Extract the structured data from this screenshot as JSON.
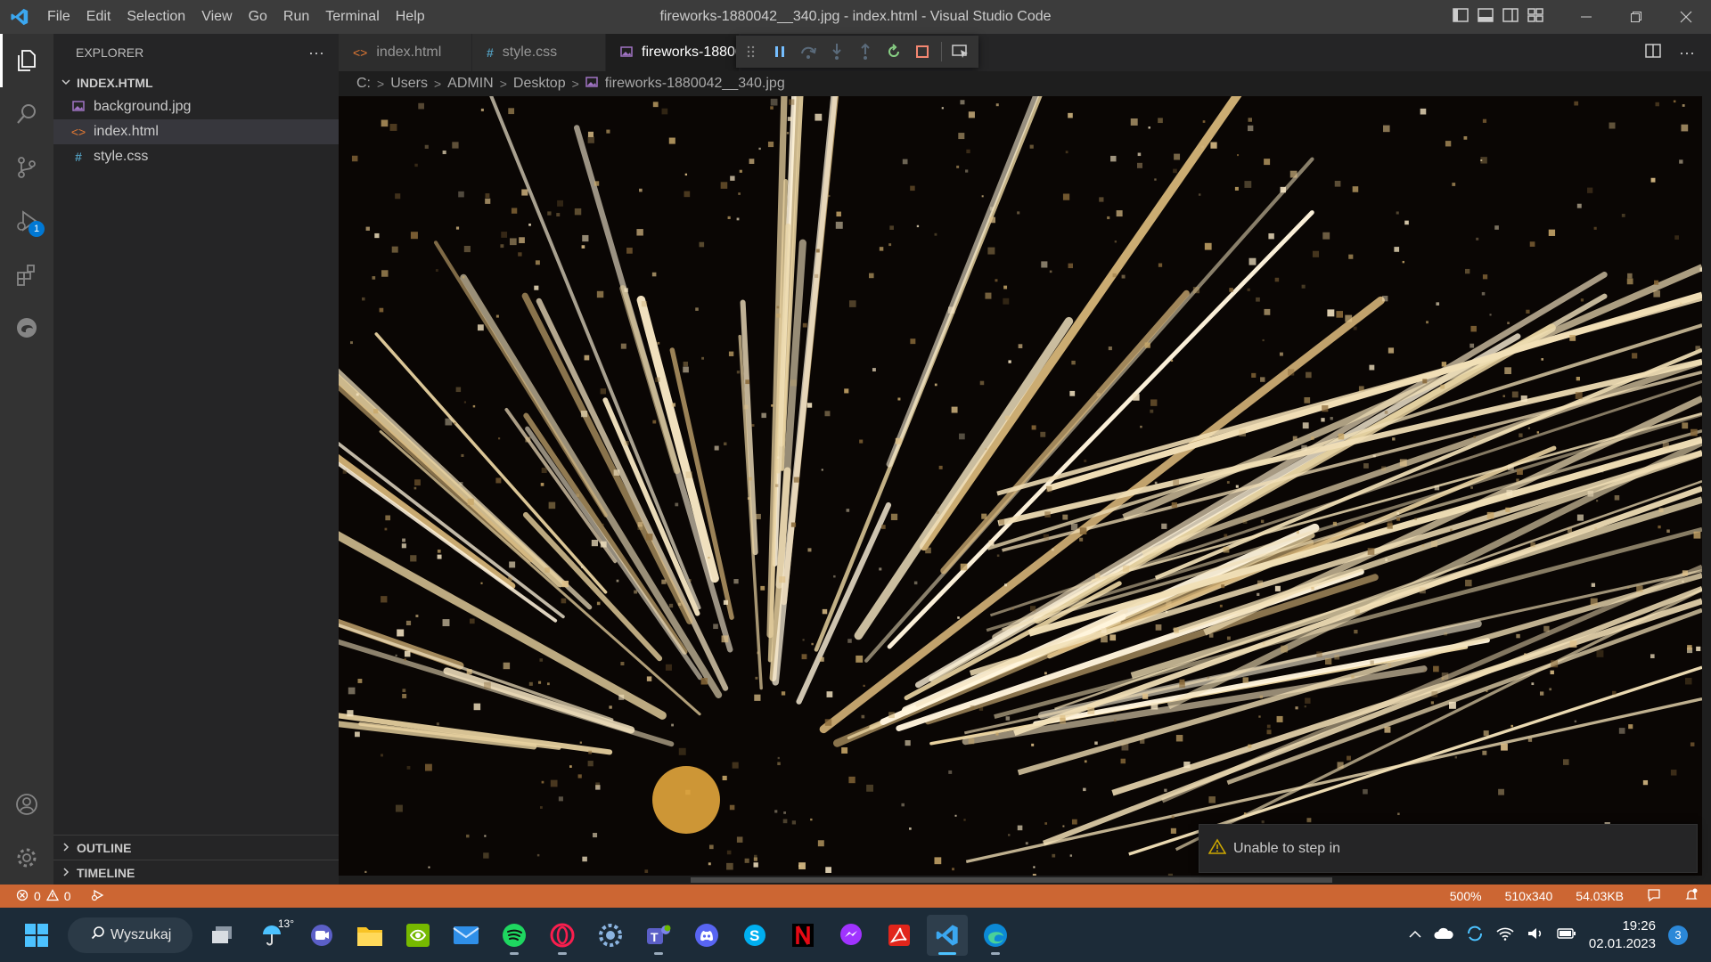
{
  "window": {
    "title": "fireworks-1880042__340.jpg - index.html - Visual Studio Code",
    "menu": [
      "File",
      "Edit",
      "Selection",
      "View",
      "Go",
      "Run",
      "Terminal",
      "Help"
    ]
  },
  "sidebar": {
    "header": "EXPLORER",
    "folder": "INDEX.HTML",
    "files": [
      {
        "name": "background.jpg",
        "icon": "image-file-icon"
      },
      {
        "name": "index.html",
        "icon": "html-file-icon",
        "selected": true
      },
      {
        "name": "style.css",
        "icon": "css-file-icon"
      }
    ],
    "outline": "OUTLINE",
    "timeline": "TIMELINE"
  },
  "tabs": [
    {
      "label": "index.html",
      "icon": "html-file-icon",
      "active": false
    },
    {
      "label": "style.css",
      "icon": "css-file-icon",
      "active": false
    },
    {
      "label": "fireworks-1880042__340.jpg",
      "icon": "image-file-icon",
      "active": true
    }
  ],
  "breadcrumb": [
    "C:",
    "Users",
    "ADMIN",
    "Desktop",
    "fireworks-1880042__340.jpg"
  ],
  "notification": {
    "text": "Unable to step in"
  },
  "statusbar": {
    "errors": "0",
    "warnings": "0",
    "zoom": "500%",
    "dimensions": "510x340",
    "filesize": "54.03KB"
  },
  "activity_badge": "1",
  "taskbar": {
    "search_label": "Wyszukaj",
    "weather": "13°",
    "time": "19:26",
    "date": "02.01.2023",
    "notifications": "3"
  },
  "colors": {
    "statusbar": "#cc6633",
    "accent": "#0078d4"
  }
}
